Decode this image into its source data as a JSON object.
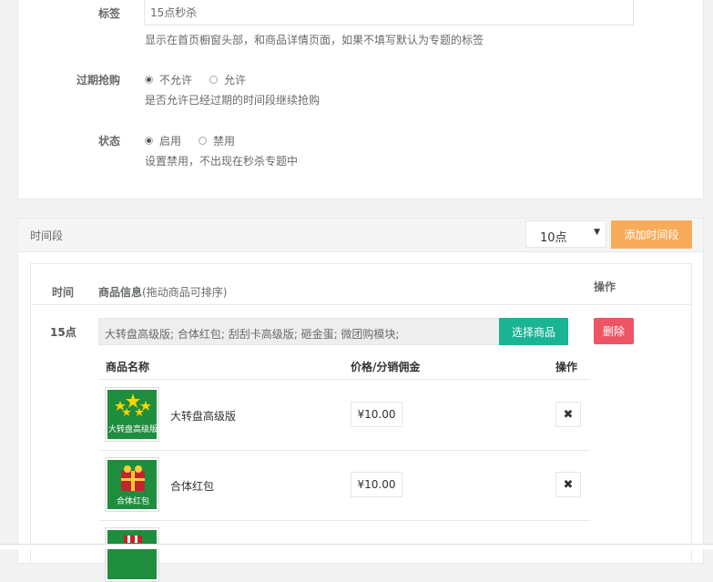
{
  "settings": {
    "tag_label": "标签",
    "tag_value": "15点秒杀",
    "tag_help": "显示在首页橱窗头部，和商品详情页面，如果不填写默认为专题的标签",
    "expired_label": "过期抢购",
    "expired_options": [
      "不允许",
      "允许"
    ],
    "expired_selected": "不允许",
    "expired_help": "是否允许已经过期的时间段继续抢购",
    "status_label": "状态",
    "status_options": [
      "启用",
      "禁用"
    ],
    "status_selected": "启用",
    "status_help": "设置禁用，不出现在秒杀专题中"
  },
  "time_section": {
    "title": "时间段",
    "select_value": "10点",
    "add_button": "添加时间段",
    "col_time": "时间",
    "col_goods": "商品信息",
    "col_goods_hint": "(拖动商品可排序)",
    "col_action": "操作",
    "rows": [
      {
        "time": "15点",
        "selected_goods": "大转盘高级版; 合体红包; 刮刮卡高级版; 砸金蛋; 微团购模块;",
        "choose_button": "选择商品",
        "delete_button": "删除",
        "sub_headers": {
          "name": "商品名称",
          "price": "价格/分销佣金",
          "action": "操作"
        },
        "goods": [
          {
            "name": "大转盘高级版",
            "price": "¥10.00",
            "image": "大转盘高级版"
          },
          {
            "name": "合体红包",
            "price": "¥10.00",
            "image": "合体红包"
          },
          {
            "name": "",
            "price": "",
            "image": ""
          }
        ]
      }
    ]
  }
}
